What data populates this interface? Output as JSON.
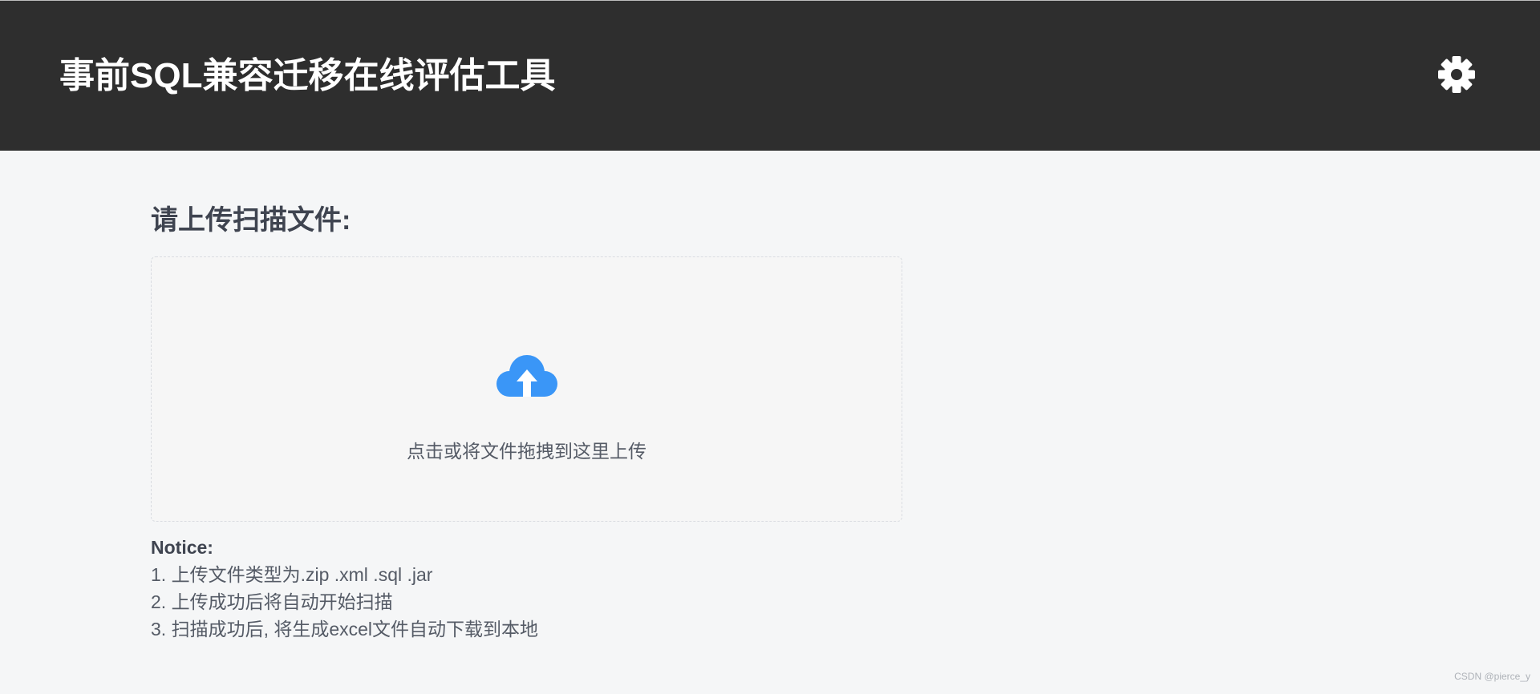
{
  "header": {
    "title": "事前SQL兼容迁移在线评估工具",
    "settings_icon": "gear-icon",
    "background": "#2e2e2e"
  },
  "main": {
    "section_title": "请上传扫描文件:",
    "upload": {
      "icon": "cloud-upload-icon",
      "icon_color": "#3a96f7",
      "text": "点击或将文件拖拽到这里上传"
    },
    "notice": {
      "title": "Notice:",
      "items": [
        "1. 上传文件类型为.zip .xml .sql .jar",
        "2. 上传成功后将自动开始扫描",
        "3. 扫描成功后, 将生成excel文件自动下载到本地"
      ]
    }
  },
  "watermark": "CSDN @pierce_y"
}
